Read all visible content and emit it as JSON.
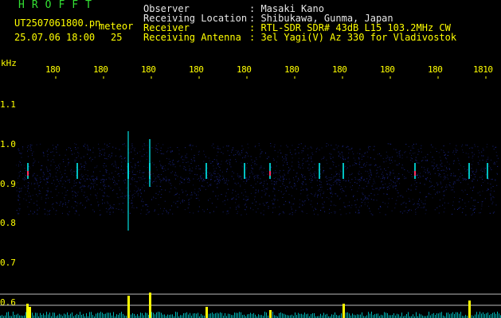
{
  "header": {
    "program": "HROFFT",
    "filename": "UT2507061800.pn",
    "meteor_label": "meteor",
    "datetime": "25.07.06 18:00",
    "count": "25"
  },
  "station": [
    {
      "label": "Observer",
      "value": ": Masaki Kano"
    },
    {
      "label": "Receiving Location",
      "value": ": Shibukawa, Gunma, Japan"
    },
    {
      "label": "Receiver",
      "value": ": RTL-SDR SDR# 43dB L15 103.2MHz CW"
    },
    {
      "label": "Receiving Antenna",
      "value": ": 3el Yagi(V) Az 330 for Vladivostok"
    }
  ],
  "axis": {
    "unit": "kHz",
    "y_ticks": [
      "1.1",
      "1.0",
      "0.9",
      "0.8",
      "0.7",
      "0.6"
    ],
    "x_ticks": [
      "180",
      "180",
      "180",
      "180",
      "180",
      "180",
      "180",
      "180",
      "180",
      "1810"
    ]
  },
  "colors": {
    "background": "#000000",
    "title_green": "#33e033",
    "text_yellow": "#ffff00",
    "text_white": "#e8e8e8",
    "spectrum_blue": "#1e2a9a",
    "echo_cyan": "#00e0e0",
    "echo_red": "#ff3060",
    "bar_yellow": "#ffff00"
  }
}
